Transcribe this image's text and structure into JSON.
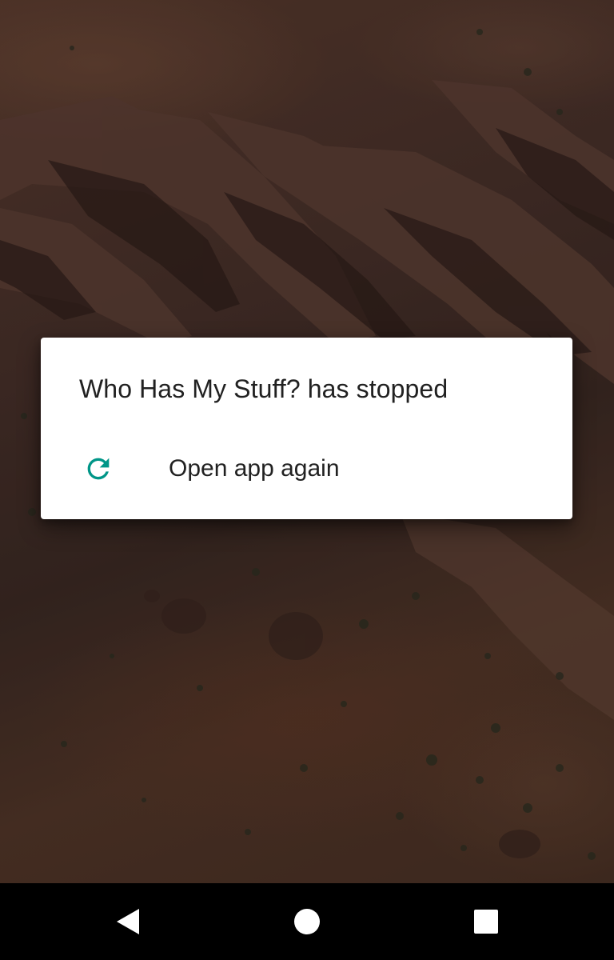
{
  "dialog": {
    "title": "Who Has My Stuff? has stopped",
    "actions": [
      {
        "label": "Open app again",
        "icon": "refresh-icon"
      }
    ]
  },
  "navbar": {
    "buttons": [
      {
        "icon": "back-icon"
      },
      {
        "icon": "home-icon"
      },
      {
        "icon": "recents-icon"
      }
    ]
  },
  "colors": {
    "accent": "#009688",
    "dialog_background": "#ffffff",
    "text_primary": "#212121",
    "navbar_background": "#000000",
    "nav_icon": "#ffffff"
  }
}
